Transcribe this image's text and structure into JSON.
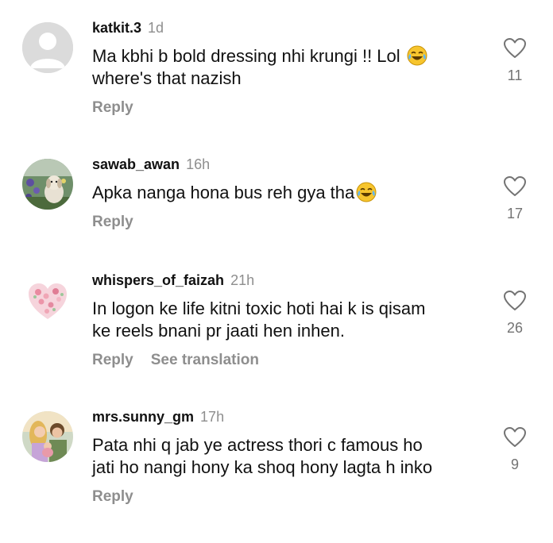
{
  "comments": [
    {
      "username": "katkit.3",
      "time": "1d",
      "line1": "Ma kbhi b bold dressing nhi krungi !! Lol",
      "line2": "where's that nazish",
      "reply": "Reply",
      "likes": "11",
      "avatar": "default-person-icon"
    },
    {
      "username": "sawab_awan",
      "time": "16h",
      "line1": "Apka nanga hona bus reh gya tha",
      "reply": "Reply",
      "likes": "17",
      "avatar": "dog-in-flower-field-photo"
    },
    {
      "username": "whispers_of_faizah",
      "time": "21h",
      "line1": "In logon ke life kitni toxic hoti hai k is qisam",
      "line2": "ke reels bnani pr jaati hen inhen.",
      "reply": "Reply",
      "see_translation": "See translation",
      "likes": "26",
      "avatar": "floral-heart-image"
    },
    {
      "username": "mrs.sunny_gm",
      "time": "17h",
      "line1": "Pata nhi q jab ye actress thori c famous ho",
      "line2": "jati ho nangi hony ka shoq hony lagta h inko",
      "reply": "Reply",
      "likes": "9",
      "avatar": "animated-couple-image"
    }
  ],
  "colors": {
    "text": "#111111",
    "muted": "#8e8e8e",
    "background": "#ffffff",
    "emoji": "#f7c52d"
  },
  "icons": {
    "like": "heart-outline-icon",
    "emoji": "face-with-tears-of-joy-icon"
  }
}
